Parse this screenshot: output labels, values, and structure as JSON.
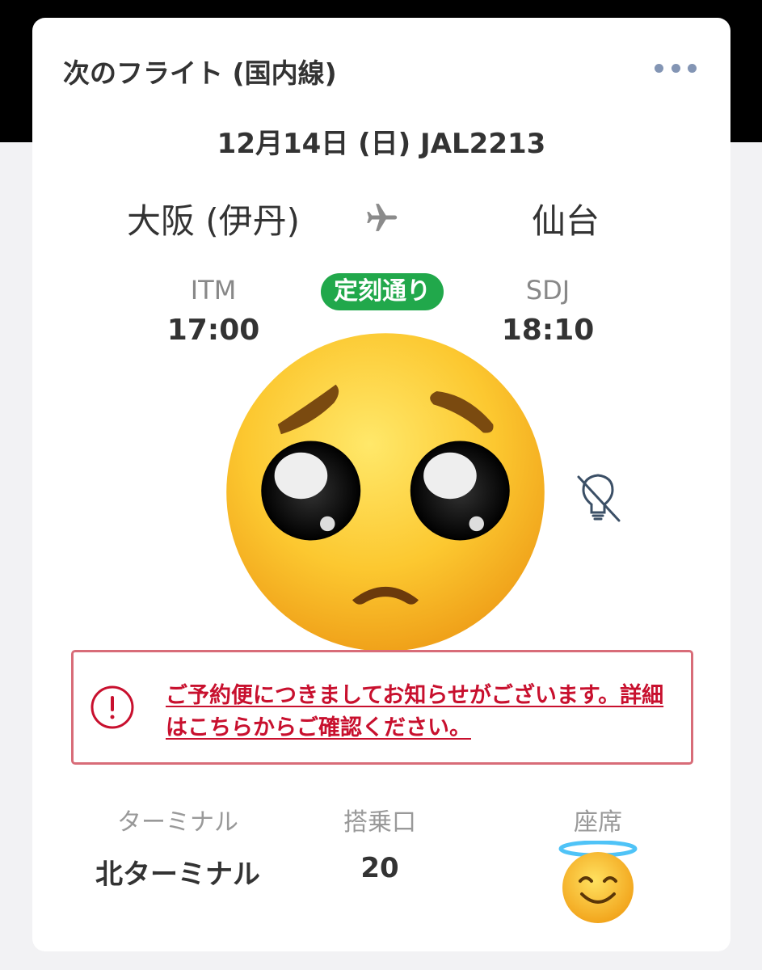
{
  "card": {
    "title": "次のフライト (国内線)",
    "more_icon": "more-horizontal-icon",
    "flight_date": "12月14日 (日) JAL2213"
  },
  "route": {
    "origin": {
      "city": "大阪 (伊丹)",
      "code": "ITM",
      "time": "17:00"
    },
    "destination": {
      "city": "仙台",
      "code": "SDJ",
      "time": "18:10"
    },
    "plane_icon": "airplane-icon",
    "status": "定刻通り"
  },
  "notice": {
    "icon": "exclamation-circle-icon",
    "text": "ご予約便につきましてお知らせがございます。詳細はこちらからご確認ください。"
  },
  "details": {
    "terminal_label": "ターミナル",
    "terminal_value": "北ターミナル",
    "gate_label": "搭乗口",
    "gate_value": "20",
    "seat_label": "座席"
  },
  "colors": {
    "status_green": "#21a84b",
    "notice_red": "#c8102e",
    "notice_border": "#d86c78",
    "menu_dots": "#8395b4"
  }
}
